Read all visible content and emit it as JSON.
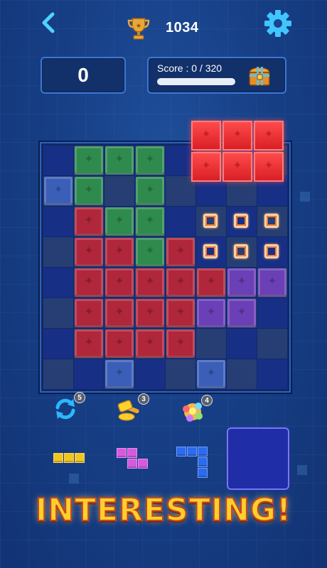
{
  "header": {
    "best_score": "1034",
    "icons": [
      "back-arrow-icon",
      "trophy-icon",
      "gear-icon"
    ]
  },
  "score": {
    "current": "0",
    "goal_text": "Score : 0 / 320",
    "goal_progress_fraction": 0.0,
    "chest_icon": "treasure-chest-icon"
  },
  "board": {
    "size": 8,
    "legend": {
      ".": "empty",
      "G": "green",
      "B": "blue",
      "R": "red",
      "P": "purple",
      "O": "target-outline"
    },
    "rows": [
      ".GGG....",
      "BG.G....",
      ".RGG.OOO",
      ".RRGROOO",
      ".RRRRRPP",
      ".RRRRPP.",
      ".RRRR...",
      "..B..B.."
    ],
    "dragging_piece": {
      "color": "red",
      "shape": [
        "XXX",
        "XXX"
      ]
    }
  },
  "boosters": [
    {
      "name": "refresh",
      "icon": "refresh-arrows-icon",
      "count": "5"
    },
    {
      "name": "hammer",
      "icon": "hammer-icon",
      "count": "3"
    },
    {
      "name": "bomb",
      "icon": "color-bomb-icon",
      "count": "4"
    }
  ],
  "tray": [
    {
      "color": "yellow",
      "shape": [
        "XXX"
      ]
    },
    {
      "color": "pink",
      "shape": [
        "XX.",
        ".XX"
      ]
    },
    {
      "color": "blue",
      "shape": [
        "XXX",
        "..X",
        "..X"
      ]
    }
  ],
  "banner": {
    "text": "INTERESTING!"
  },
  "colors": {
    "green": "#2f8a4e",
    "blue": "#3b5fb8",
    "red": "#b0263a",
    "purple": "#6b3fb5",
    "yellow": "#f3c61e",
    "pink": "#d65ae0",
    "tray_blue": "#2a6bf0",
    "accent_gold": "#ffcf2d"
  }
}
